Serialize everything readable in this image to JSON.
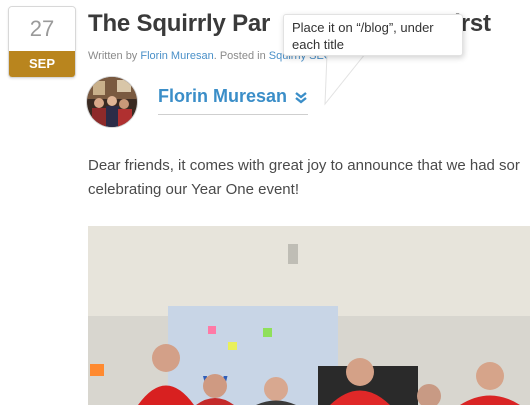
{
  "date": {
    "day": "27",
    "month": "SEP"
  },
  "post": {
    "title": "The Squirrly Par",
    "title_end": "y First",
    "meta_prefix": "Written by ",
    "meta_author": "Florin Muresan",
    "meta_mid": ". Posted in ",
    "meta_category": "Squirrly SEO Blog",
    "author_name": "Florin Muresan",
    "body_line1": "Dear friends, it comes with great joy to announce that we had sor",
    "body_line2": "celebrating our Year One event!"
  },
  "tooltip": {
    "text": "Place it on “/blog”, under each title"
  },
  "colors": {
    "link": "#3b8ec8",
    "month_bg": "#b9851e",
    "title": "#3a3a3a"
  },
  "icons": {
    "author_toggle": "double-chevron-down-icon"
  }
}
